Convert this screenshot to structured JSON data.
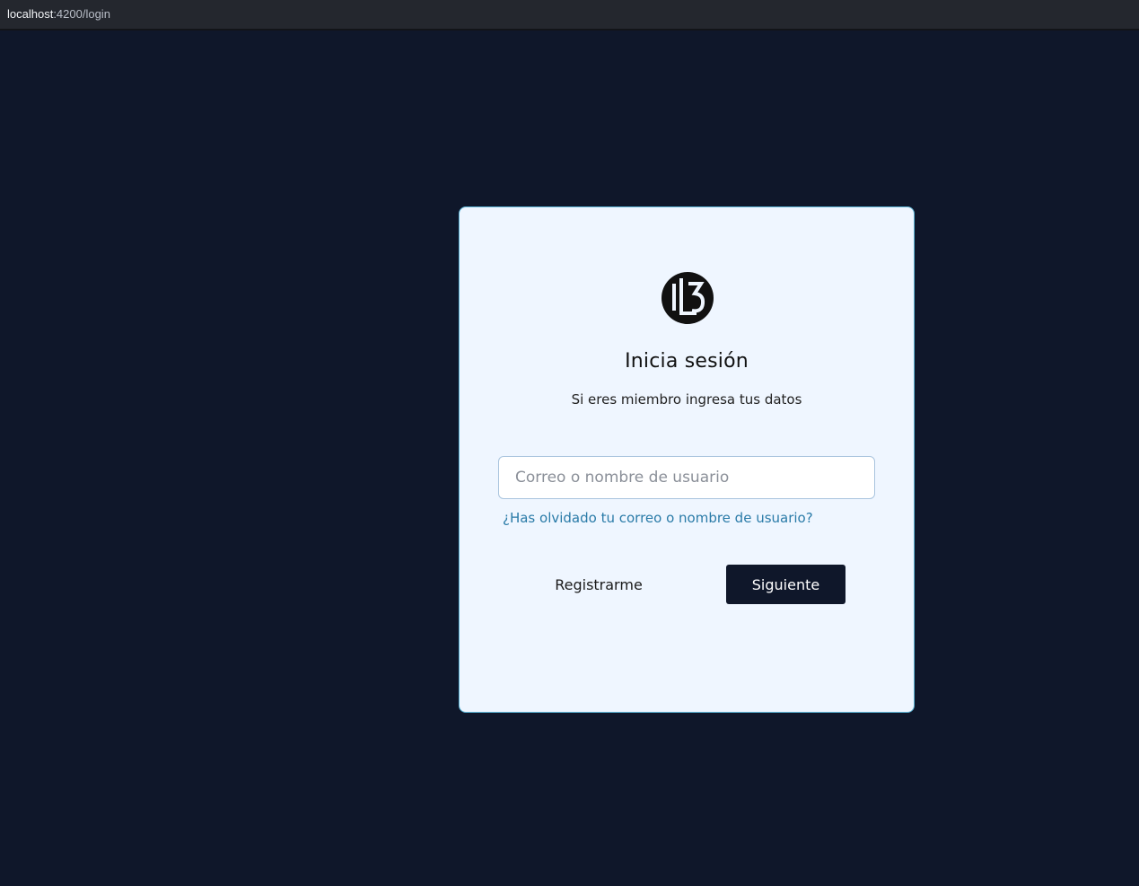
{
  "browser": {
    "url_host": "localhost",
    "url_rest": ":4200/login"
  },
  "login": {
    "logo_icon": "brand-monogram-icon",
    "title": "Inicia sesión",
    "subtitle": "Si eres miembro ingresa tus datos",
    "username_field": {
      "value": "",
      "placeholder": "Correo o nombre de usuario"
    },
    "forgot_link": "¿Has olvidado tu correo o nombre de usuario?",
    "register_label": "Registrarme",
    "next_label": "Siguiente"
  },
  "colors": {
    "page_background": "#0f172a",
    "card_background": "#eff6ff",
    "card_border": "#5eb6d8",
    "link": "#2a7ba8",
    "primary_button": "#0f172a"
  }
}
